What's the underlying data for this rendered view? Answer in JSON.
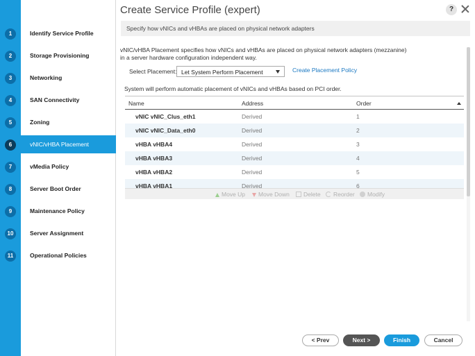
{
  "wizard": {
    "title": "Create Service Profile (expert)",
    "help_label": "?",
    "banner": "Specify how vNICs and vHBAs are placed on physical network adapters"
  },
  "steps": [
    {
      "num": "1",
      "label": "Identify Service Profile"
    },
    {
      "num": "2",
      "label": "Storage Provisioning"
    },
    {
      "num": "3",
      "label": "Networking"
    },
    {
      "num": "4",
      "label": "SAN Connectivity"
    },
    {
      "num": "5",
      "label": "Zoning"
    },
    {
      "num": "6",
      "label": "vNIC/vHBA Placement"
    },
    {
      "num": "7",
      "label": "vMedia Policy"
    },
    {
      "num": "8",
      "label": "Server Boot Order"
    },
    {
      "num": "9",
      "label": "Maintenance Policy"
    },
    {
      "num": "10",
      "label": "Server Assignment"
    },
    {
      "num": "11",
      "label": "Operational Policies"
    }
  ],
  "placement": {
    "description_line1": "vNIC/vHBA Placement specifies how vNICs and vHBAs are placed on physical network adapters (mezzanine)",
    "description_line2": "in a server hardware configuration independent way.",
    "select_label": "Select Placement:",
    "select_value": "Let System Perform Placement",
    "create_link": "Create Placement Policy",
    "auto_message": "System will perform automatic placement of vNICs and vHBAs based on PCI order."
  },
  "table": {
    "headers": {
      "name": "Name",
      "address": "Address",
      "order": "Order"
    },
    "rows": [
      {
        "name": "vNIC vNIC_Clus_eth1",
        "address": "Derived",
        "order": "1"
      },
      {
        "name": "vNIC vNIC_Data_eth0",
        "address": "Derived",
        "order": "2"
      },
      {
        "name": "vHBA vHBA4",
        "address": "Derived",
        "order": "3"
      },
      {
        "name": "vHBA vHBA3",
        "address": "Derived",
        "order": "4"
      },
      {
        "name": "vHBA vHBA2",
        "address": "Derived",
        "order": "5"
      },
      {
        "name": "vHBA vHBA1",
        "address": "Derived",
        "order": "6"
      }
    ],
    "toolbar": {
      "move_up": "Move Up",
      "move_down": "Move Down",
      "delete": "Delete",
      "reorder": "Reorder",
      "modify": "Modify"
    }
  },
  "footer": {
    "prev": "< Prev",
    "next": "Next >",
    "finish": "Finish",
    "cancel": "Cancel"
  },
  "colors": {
    "accent": "#1a9bdc",
    "step_badge": "#0c6ea8",
    "next_button": "#555555"
  }
}
